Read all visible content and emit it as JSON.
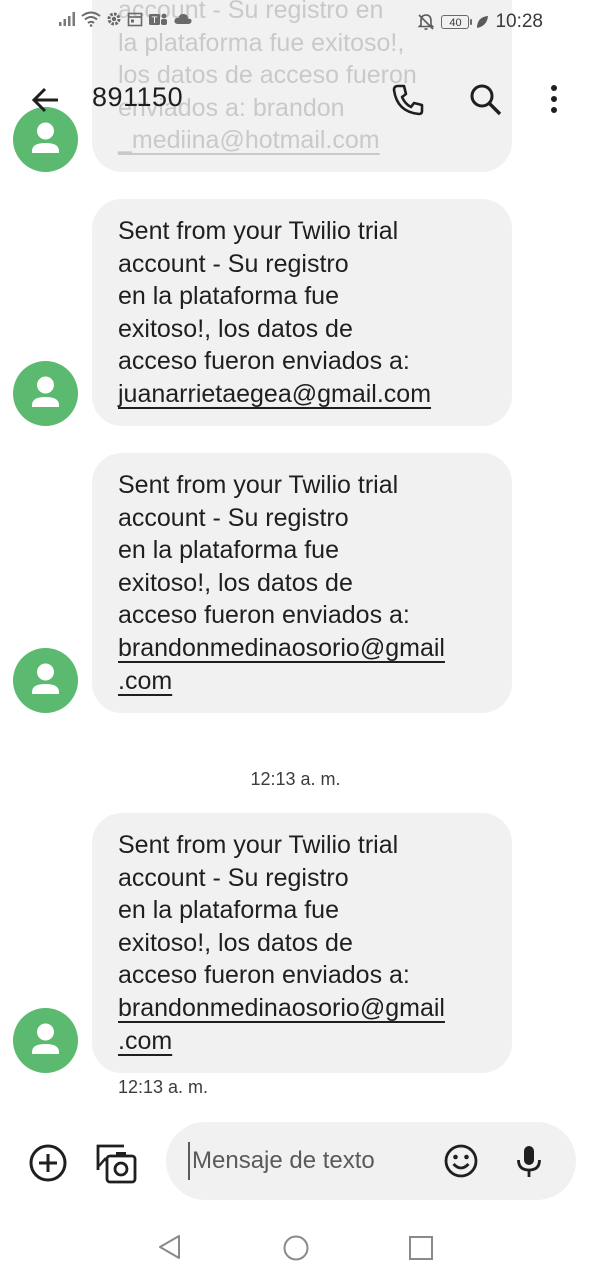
{
  "status_bar": {
    "time": "10:28",
    "battery": "40"
  },
  "conversation": {
    "title": "891150"
  },
  "messages": [
    {
      "lines": [
        "account - Su registro en",
        "la plataforma fue exitoso!,",
        "los datos de acceso fueron",
        "enviados a: brandon"
      ],
      "link": "_mediina@hotmail.com"
    },
    {
      "lines": [
        "Sent from your Twilio trial",
        "account - Su registro",
        "en la plataforma fue",
        "exitoso!, los datos de",
        "acceso fueron enviados a:"
      ],
      "link_lines": [
        "juanarrietaegea@gmail.com"
      ]
    },
    {
      "lines": [
        "Sent from your Twilio trial",
        "account - Su registro",
        "en la plataforma fue",
        "exitoso!, los datos de",
        "acceso fueron enviados a:"
      ],
      "link_lines": [
        "brandonmedinaosorio@gmail",
        ".com"
      ]
    },
    {
      "lines": [
        "Sent from your Twilio trial",
        "account - Su registro",
        "en la plataforma fue",
        "exitoso!, los datos de",
        "acceso fueron enviados a:"
      ],
      "link_lines": [
        "brandonmedinaosorio@gmail",
        ".com"
      ]
    }
  ],
  "divider_timestamp": "12:13 a. m.",
  "last_message_timestamp": "12:13 a. m.",
  "compose": {
    "placeholder": "Mensaje de texto"
  },
  "colors": {
    "avatar": "#5bba6f",
    "bubble": "#f1f1f1",
    "compose": "#f1f1f1"
  },
  "icons": {
    "back": "arrow-left-icon",
    "call": "phone-icon",
    "search": "search-icon",
    "more": "more-vert-icon",
    "add": "add-circle-icon",
    "gallery": "gallery-icon",
    "emoji": "emoji-icon",
    "mic": "mic-icon"
  }
}
